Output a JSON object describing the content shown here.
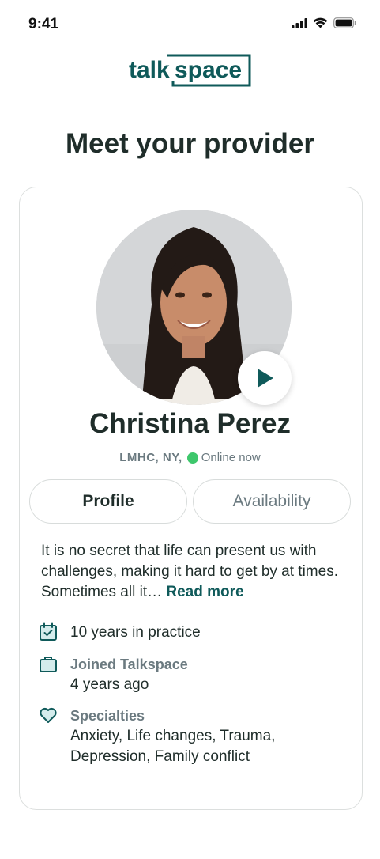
{
  "status_bar": {
    "time": "9:41"
  },
  "logo": {
    "part1": "talk",
    "part2": "space"
  },
  "page": {
    "title": "Meet your provider"
  },
  "provider": {
    "name": "Christina Perez",
    "credentials": "LMHC, NY,",
    "online_status": "Online now",
    "bio": "It is no secret that life can present us with challenges, making it hard to get by at times. Sometimes all it…",
    "read_more": "Read more"
  },
  "tabs": [
    {
      "label": "Profile",
      "active": true
    },
    {
      "label": "Availability",
      "active": false
    }
  ],
  "facts": {
    "experience": "10 years in practice",
    "joined_label": "Joined Talkspace",
    "joined_value": "4 years ago",
    "specialties_label": "Specialties",
    "specialties_line1": "Anxiety, Life changes, Trauma,",
    "specialties_line2": "Depression, Family conflict"
  },
  "colors": {
    "brand": "#0f5a5a",
    "online": "#3ec76c",
    "muted": "#6b7a80",
    "text": "#1f2d2a"
  },
  "icons": [
    "signal-icon",
    "wifi-icon",
    "battery-icon",
    "play-icon",
    "calendar-check-icon",
    "briefcase-icon",
    "heart-icon"
  ]
}
